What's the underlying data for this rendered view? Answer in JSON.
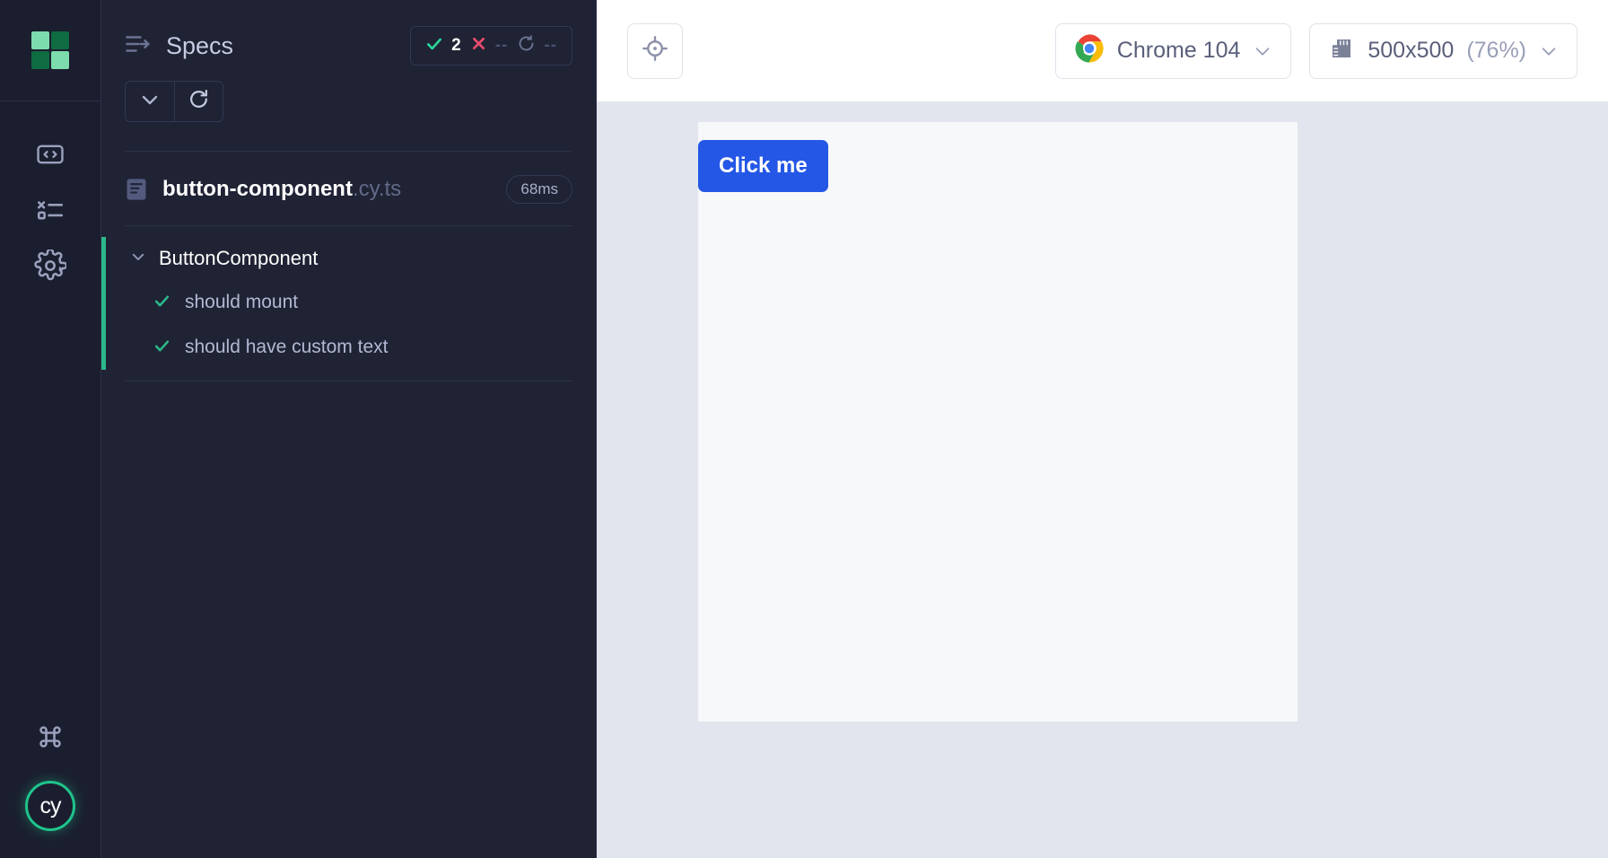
{
  "colors": {
    "rail_bg": "#1b1e2e",
    "panel_bg": "#1f2334",
    "accent_green": "#2bb98a",
    "fail_red": "#ef4b6b",
    "brand_blue": "#2457e6",
    "canvas_bg": "#e1e5ee",
    "aut_bg": "#f7f8fa"
  },
  "rail": {
    "logo_name": "cypress-project-logo",
    "logo_colors": [
      "#7ddcae",
      "#0f6b42",
      "#0f6b42",
      "#7ddcae"
    ],
    "items": [
      {
        "name": "specs-icon",
        "label": "Specs"
      },
      {
        "name": "runs-icon",
        "label": "Runs"
      },
      {
        "name": "settings-icon",
        "label": "Settings"
      }
    ],
    "bottom": [
      {
        "name": "keyboard-shortcuts-icon",
        "label": "Keyboard Shortcuts"
      },
      {
        "name": "cypress-logo-badge",
        "label": "cy"
      }
    ]
  },
  "specs": {
    "header_icon": "specs-list-icon",
    "title": "Specs",
    "stats": {
      "passed_icon": "check-icon",
      "passed": "2",
      "failed_icon": "x-icon",
      "failed": "--",
      "pending_icon": "spinner-icon",
      "pending": "--"
    },
    "controls": [
      {
        "name": "collapse-button",
        "icon": "chevron-down-icon"
      },
      {
        "name": "rerun-button",
        "icon": "refresh-icon"
      }
    ],
    "spec": {
      "icon": "file-icon",
      "name": "button-component",
      "extension": ".cy.ts",
      "duration": "68ms"
    },
    "suite": {
      "chevron": "chevron-down-icon",
      "name": "ButtonComponent",
      "tests": [
        {
          "status_icon": "check-icon",
          "name": "should mount"
        },
        {
          "status_icon": "check-icon",
          "name": "should have custom text"
        }
      ]
    }
  },
  "toolbar": {
    "selector_playground": {
      "name": "selector-playground-button",
      "icon": "crosshair-icon"
    },
    "browser": {
      "icon": "chrome-icon",
      "label": "Chrome 104",
      "chevron": "chevron-down-icon"
    },
    "viewport": {
      "icon": "ruler-icon",
      "size": "500x500",
      "scale": "(76%)",
      "chevron": "chevron-down-icon"
    }
  },
  "aut": {
    "button_label": "Click me"
  }
}
